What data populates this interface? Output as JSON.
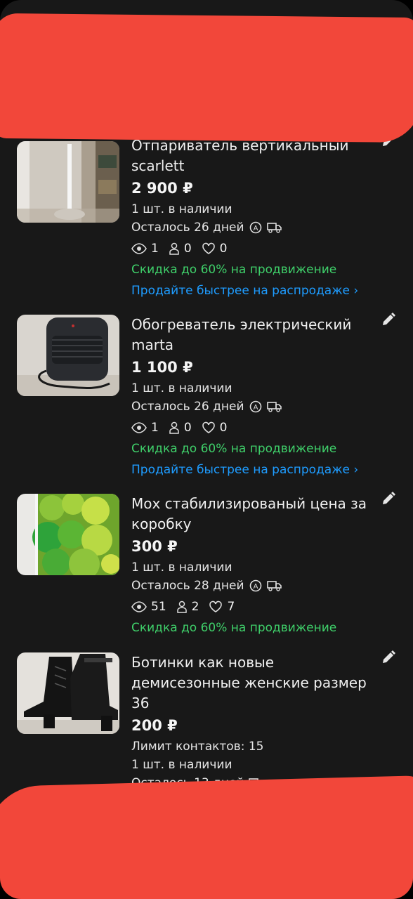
{
  "listings": [
    {
      "title": "Отпариватель вертикальный scarlett",
      "price": "2 900 ₽",
      "stock": "1 шт. в наличии",
      "remaining": "Осталось 26 дней",
      "views": "1",
      "contacts": "0",
      "favorites": "0",
      "promo": "Скидка до 60% на продвижение",
      "sale_link": "Продайте быстрее на распродаже ›"
    },
    {
      "title": "Обогреватель электрический marta",
      "price": "1 100 ₽",
      "stock": "1 шт. в наличии",
      "remaining": "Осталось 26 дней",
      "views": "1",
      "contacts": "0",
      "favorites": "0",
      "promo": "Скидка до 60% на продвижение",
      "sale_link": "Продайте быстрее на распродаже ›"
    },
    {
      "title": "Мох стабилизированый цена за коробку",
      "price": "300 ₽",
      "stock": "1 шт. в наличии",
      "remaining": "Осталось 28 дней",
      "views": "51",
      "contacts": "2",
      "favorites": "7",
      "promo": "Скидка до 60% на продвижение"
    },
    {
      "title": "Ботинки как новые демисезонные женские размер 36",
      "price": "200 ₽",
      "contact_limit": "Лимит контактов: 15",
      "stock": "1 шт. в наличии",
      "remaining": "Осталось 13 дней"
    }
  ],
  "colors": {
    "background": "#181818",
    "promo_green": "#3fd06a",
    "link_blue": "#1e9cff",
    "redaction": "#f2473a"
  },
  "icons": [
    "edit-pencil-icon",
    "autopublish-icon",
    "delivery-truck-icon",
    "eye-icon",
    "person-icon",
    "heart-icon"
  ]
}
